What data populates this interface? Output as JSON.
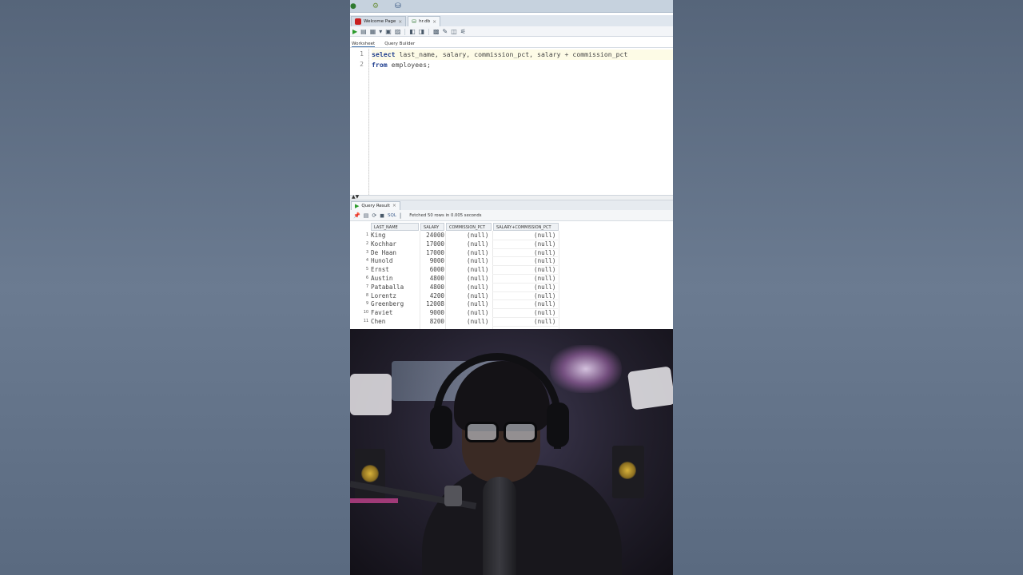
{
  "ide": {
    "doc_tabs": [
      {
        "label": "Welcome Page",
        "active": false
      },
      {
        "label": "hr.db",
        "active": true
      }
    ],
    "sub_tabs": [
      "Worksheet",
      "Query Builder"
    ],
    "editor": {
      "lines": [
        {
          "number": "1",
          "keyword": "select",
          "rest": " last_name, salary, commission_pct, salary + commission_pct"
        },
        {
          "number": "2",
          "keyword": "from",
          "rest": " employees;"
        }
      ]
    },
    "result": {
      "tab_label": "Query Result",
      "sql_label": "SQL",
      "fetched_text": "Fetched 50 rows in 0.005 seconds",
      "columns": [
        "LAST_NAME",
        "SALARY",
        "COMMISSION_PCT",
        "SALARY+COMMISSION_PCT"
      ],
      "rows": [
        {
          "num": "1",
          "last_name": "King",
          "salary": "24000",
          "commission_pct": "(null)",
          "sum": "(null)"
        },
        {
          "num": "2",
          "last_name": "Kochhar",
          "salary": "17000",
          "commission_pct": "(null)",
          "sum": "(null)"
        },
        {
          "num": "3",
          "last_name": "De Haan",
          "salary": "17000",
          "commission_pct": "(null)",
          "sum": "(null)"
        },
        {
          "num": "4",
          "last_name": "Hunold",
          "salary": "9000",
          "commission_pct": "(null)",
          "sum": "(null)"
        },
        {
          "num": "5",
          "last_name": "Ernst",
          "salary": "6000",
          "commission_pct": "(null)",
          "sum": "(null)"
        },
        {
          "num": "6",
          "last_name": "Austin",
          "salary": "4800",
          "commission_pct": "(null)",
          "sum": "(null)"
        },
        {
          "num": "7",
          "last_name": "Pataballa",
          "salary": "4800",
          "commission_pct": "(null)",
          "sum": "(null)"
        },
        {
          "num": "8",
          "last_name": "Lorentz",
          "salary": "4200",
          "commission_pct": "(null)",
          "sum": "(null)"
        },
        {
          "num": "9",
          "last_name": "Greenberg",
          "salary": "12008",
          "commission_pct": "(null)",
          "sum": "(null)"
        },
        {
          "num": "10",
          "last_name": "Faviet",
          "salary": "9000",
          "commission_pct": "(null)",
          "sum": "(null)"
        },
        {
          "num": "11",
          "last_name": "Chen",
          "salary": "8200",
          "commission_pct": "(null)",
          "sum": "(null)"
        }
      ]
    }
  },
  "colors": {
    "keyword": "#1f3e8f",
    "toolbar_bg": "#f3f5f8",
    "outer_bg": "#5f6f85"
  }
}
